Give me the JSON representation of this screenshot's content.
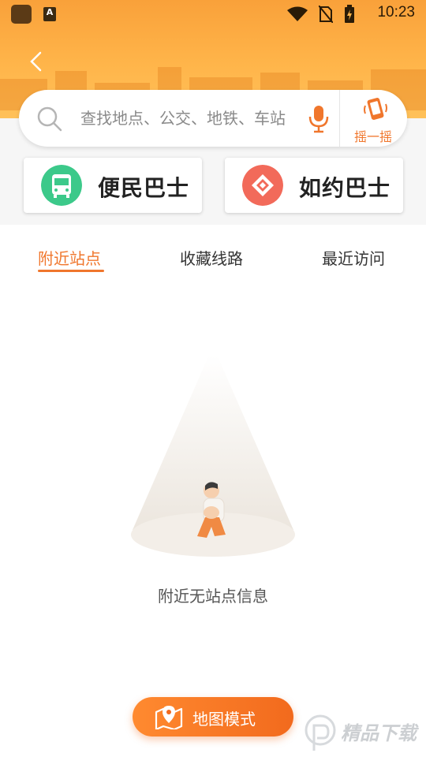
{
  "status_bar": {
    "time": "10:23",
    "app_badge": "A"
  },
  "search": {
    "placeholder": "查找地点、公交、地铁、车站",
    "shake_label": "摇一摇"
  },
  "services": [
    {
      "label": "便民巴士",
      "color": "#3cc98a"
    },
    {
      "label": "如约巴士",
      "color": "#f26a5a"
    }
  ],
  "tabs": [
    {
      "label": "附近站点",
      "active": true
    },
    {
      "label": "收藏线路",
      "active": false
    },
    {
      "label": "最近访问",
      "active": false
    }
  ],
  "empty_state": {
    "message": "附近无站点信息"
  },
  "map_mode": {
    "label": "地图模式"
  },
  "watermark": {
    "text": "精品下载"
  },
  "colors": {
    "accent": "#f0762c",
    "header": "#ffb54a"
  }
}
